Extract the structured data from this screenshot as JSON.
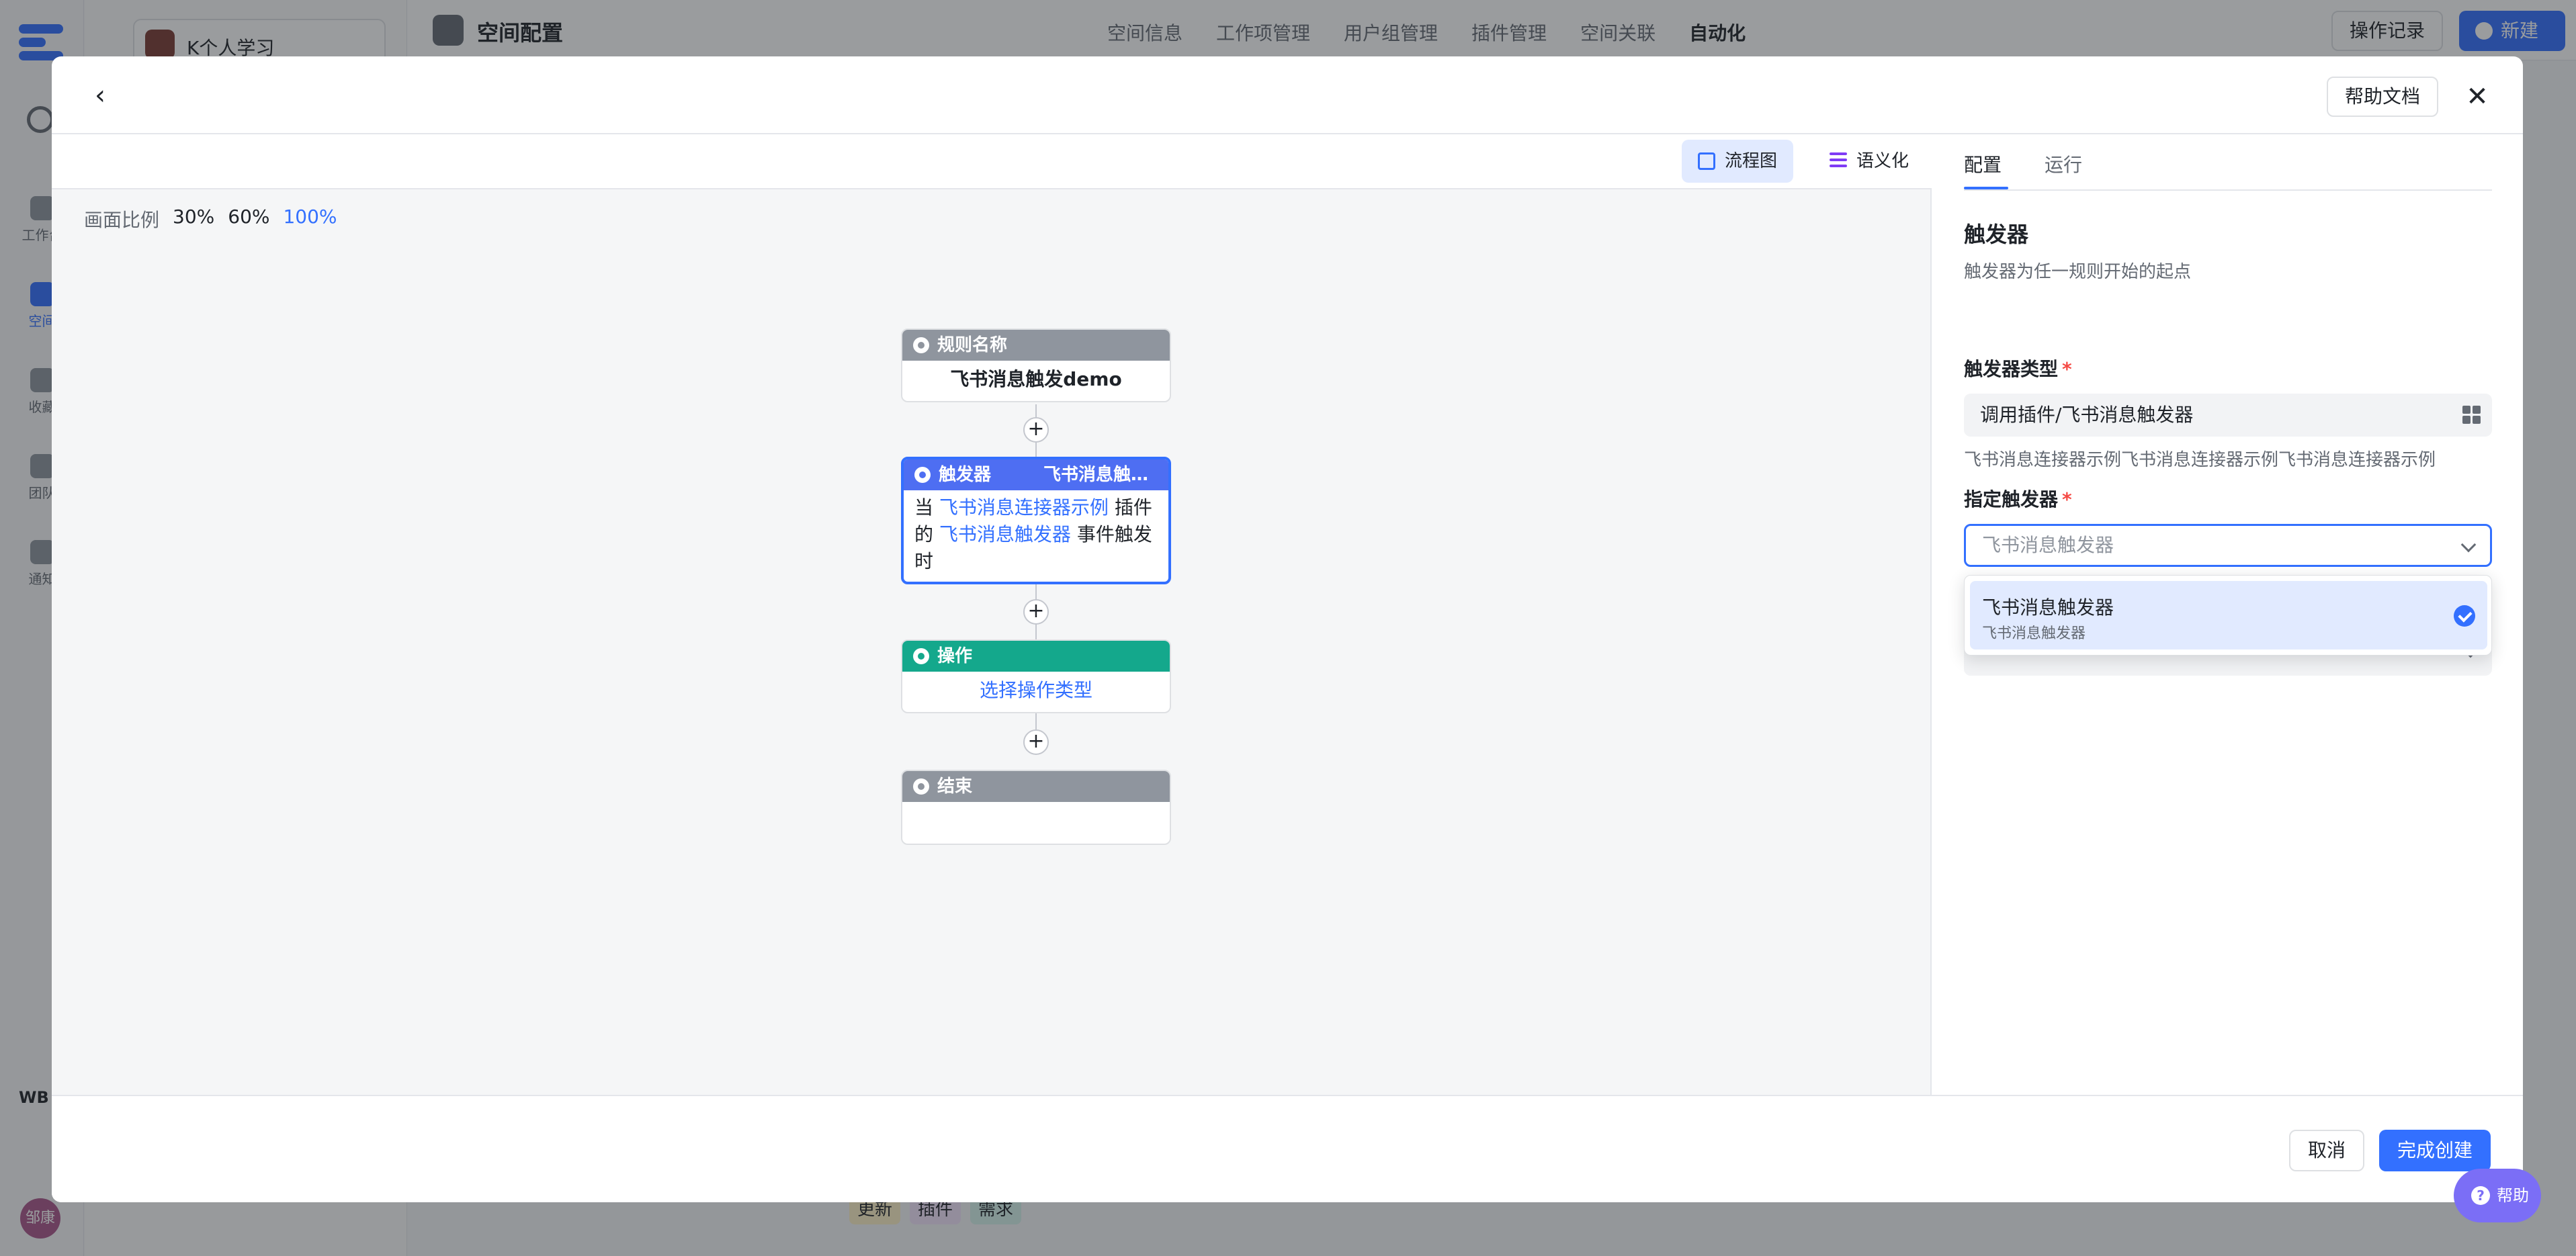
{
  "background": {
    "workspace_name": "K个人学习",
    "page_title": "空间配置",
    "tabs": [
      "空间信息",
      "工作项管理",
      "用户组管理",
      "插件管理",
      "空间关联",
      "自动化"
    ],
    "op_record_label": "操作记录",
    "new_label": "新建",
    "nav": [
      "工作台",
      "空间",
      "收藏",
      "团队",
      "通知"
    ],
    "wb_label": "WB",
    "avatar_text": "邹康",
    "tags": [
      "更新",
      "插件",
      "需求"
    ]
  },
  "modal": {
    "help_doc_label": "帮助文档",
    "view_toggle": {
      "flowchart_label": "流程图",
      "semantic_label": "语义化"
    },
    "zoom": {
      "label": "画面比例",
      "options": [
        "30%",
        "60%",
        "100%"
      ],
      "selected": "100%"
    },
    "nodes": {
      "rule": {
        "header": "规则名称",
        "value": "飞书消息触发demo"
      },
      "trigger": {
        "header": "触发器",
        "header_extra": "飞书消息触发器",
        "prefix": "当",
        "plugin_link": "飞书消息连接器示例",
        "middle": "插件的",
        "event_link": "飞书消息触发器",
        "suffix": "事件触发时"
      },
      "action": {
        "header": "操作",
        "value": "选择操作类型"
      },
      "end": {
        "header": "结束"
      }
    },
    "panel": {
      "tabs": [
        "配置",
        "运行"
      ],
      "section_title": "触发器",
      "section_desc": "触发器为任一规则开始的起点",
      "trigger_type_label": "触发器类型",
      "trigger_type_value": "调用插件/飞书消息触发器",
      "trigger_type_hint": "飞书消息连接器示例飞书消息连接器示例飞书消息连接器示例",
      "specify_label": "指定触发器",
      "specify_placeholder": "飞书消息触发器",
      "dropdown_option": {
        "title": "飞书消息触发器",
        "subtitle": "飞书消息触发器",
        "selected": true
      }
    },
    "footer": {
      "cancel_label": "取消",
      "finish_label": "完成创建"
    }
  },
  "help_float_label": "帮助",
  "colors": {
    "accent": "#3370ff",
    "action": "#14a88c",
    "trigger": "#4e6ef2",
    "gray_header": "#8f959e"
  }
}
